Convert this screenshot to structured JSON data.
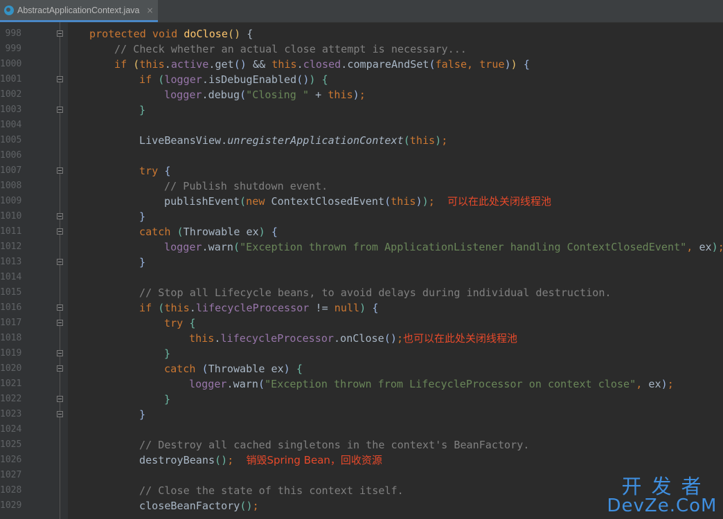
{
  "tab": {
    "label": "AbstractApplicationContext.java",
    "close": "×",
    "icon": "java-class-icon"
  },
  "lines": [
    {
      "num": "998",
      "fold": true
    },
    {
      "num": "999"
    },
    {
      "num": "1000"
    },
    {
      "num": "1001",
      "fold": true
    },
    {
      "num": "1002"
    },
    {
      "num": "1003",
      "fold": true
    },
    {
      "num": "1004"
    },
    {
      "num": "1005"
    },
    {
      "num": "1006"
    },
    {
      "num": "1007",
      "fold": true
    },
    {
      "num": "1008"
    },
    {
      "num": "1009"
    },
    {
      "num": "1010",
      "fold": true
    },
    {
      "num": "1011",
      "fold": true
    },
    {
      "num": "1012"
    },
    {
      "num": "1013",
      "fold": true
    },
    {
      "num": "1014"
    },
    {
      "num": "1015"
    },
    {
      "num": "1016",
      "fold": true
    },
    {
      "num": "1017",
      "fold": true
    },
    {
      "num": "1018"
    },
    {
      "num": "1019",
      "fold": true
    },
    {
      "num": "1020",
      "fold": true
    },
    {
      "num": "1021"
    },
    {
      "num": "1022",
      "fold": true
    },
    {
      "num": "1023",
      "fold": true
    },
    {
      "num": "1024"
    },
    {
      "num": "1025"
    },
    {
      "num": "1026"
    },
    {
      "num": "1027"
    },
    {
      "num": "1028"
    },
    {
      "num": "1029"
    }
  ],
  "code": {
    "l998": {
      "protected": "protected",
      "void": "void",
      "fn": "doClose",
      "p1": "(",
      "p2": ")",
      "b1": "{"
    },
    "l999": {
      "comment": "// Check whether an actual close attempt is necessary..."
    },
    "l1000": {
      "if": "if",
      "p1": "(",
      "this1": "this",
      "active": "active",
      "get": "get",
      "p2": "()",
      "and": "&&",
      "this2": "this",
      "closed": "closed",
      "cas": "compareAndSet",
      "p3": "(",
      "false": "false",
      "true": "true",
      "p4": ")",
      "p5": ")",
      "b1": "{"
    },
    "l1001": {
      "if": "if",
      "p1": "(",
      "logger": "logger",
      "method": "isDebugEnabled",
      "p2": "()",
      "p3": ")",
      "b1": "{"
    },
    "l1002": {
      "logger": "logger",
      "method": "debug",
      "p1": "(",
      "str": "\"Closing \"",
      "plus": "+",
      "this": "this",
      "p2": ")",
      "semi": ";"
    },
    "l1003": {
      "b1": "}"
    },
    "l1005": {
      "cls": "LiveBeansView",
      "method": "unregisterApplicationContext",
      "p1": "(",
      "this": "this",
      "p2": ")",
      "semi": ";"
    },
    "l1007": {
      "try": "try",
      "b1": "{"
    },
    "l1008": {
      "comment": "// Publish shutdown event."
    },
    "l1009": {
      "method": "publishEvent",
      "p1": "(",
      "new": "new",
      "cls": "ContextClosedEvent",
      "p2": "(",
      "this": "this",
      "p3": ")",
      "p4": ")",
      "semi": ";",
      "note": "可以在此处关闭线程池"
    },
    "l1010": {
      "b1": "}"
    },
    "l1011": {
      "catch": "catch",
      "p1": "(",
      "type": "Throwable ex",
      "p2": ")",
      "b1": "{"
    },
    "l1012": {
      "logger": "logger",
      "method": "warn",
      "p1": "(",
      "str": "\"Exception thrown from ApplicationListener handling ContextClosedEvent\"",
      "arg": "ex",
      "p2": ")",
      "semi": ";"
    },
    "l1013": {
      "b1": "}"
    },
    "l1015": {
      "comment": "// Stop all Lifecycle beans, to avoid delays during individual destruction."
    },
    "l1016": {
      "if": "if",
      "p1": "(",
      "this": "this",
      "field": "lifecycleProcessor",
      "neq": "!=",
      "null": "null",
      "p2": ")",
      "b1": "{"
    },
    "l1017": {
      "try": "try",
      "b1": "{"
    },
    "l1018": {
      "this": "this",
      "field": "lifecycleProcessor",
      "method": "onClose",
      "p1": "()",
      "semi": ";",
      "note": "也可以在此处关闭线程池"
    },
    "l1019": {
      "b1": "}"
    },
    "l1020": {
      "catch": "catch",
      "p1": "(",
      "type": "Throwable ex",
      "p2": ")",
      "b1": "{"
    },
    "l1021": {
      "logger": "logger",
      "method": "warn",
      "p1": "(",
      "str": "\"Exception thrown from LifecycleProcessor on context close\"",
      "arg": "ex",
      "p2": ")",
      "semi": ";"
    },
    "l1022": {
      "b1": "}"
    },
    "l1023": {
      "b1": "}"
    },
    "l1025": {
      "comment": "// Destroy all cached singletons in the context's BeanFactory."
    },
    "l1026": {
      "method": "destroyBeans",
      "p1": "()",
      "semi": ";",
      "note": "销毁Spring Bean，回收资源"
    },
    "l1028": {
      "comment": "// Close the state of this context itself."
    },
    "l1029": {
      "method": "closeBeanFactory",
      "p1": "()",
      "semi": ";"
    }
  },
  "watermark": {
    "top": "开发者",
    "bottom": "DevZe.CoM"
  }
}
